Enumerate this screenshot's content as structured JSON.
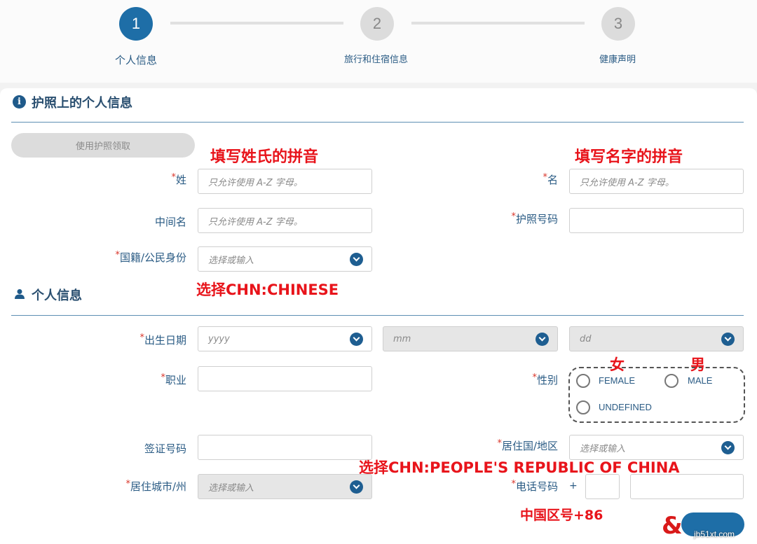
{
  "steps": [
    {
      "number": "1",
      "label": "个人信息"
    },
    {
      "number": "2",
      "label": "旅行和住宿信息"
    },
    {
      "number": "3",
      "label": "健康声明"
    }
  ],
  "passport_section": {
    "title": "护照上的个人信息",
    "read_button": "使用护照领取"
  },
  "personal_section": {
    "title": "个人信息"
  },
  "labels": {
    "surname": "姓",
    "given_name": "名",
    "middle_name": "中间名",
    "passport_no": "护照号码",
    "nationality": "国籍/公民身份",
    "dob": "出生日期",
    "occupation": "职业",
    "gender": "性别",
    "visa_no": "签证号码",
    "country_residence": "居住国/地区",
    "city_residence": "居住城市/州",
    "phone": "电话号码",
    "required_mark": "*",
    "phone_plus": "+"
  },
  "placeholders": {
    "alpha_only": "只允许使用 A-Z 字母。",
    "select_or_input": "选择或输入",
    "yyyy": "yyyy",
    "mm": "mm",
    "dd": "dd"
  },
  "gender_options": {
    "female": "FEMALE",
    "male": "MALE",
    "undefined": "UNDEFINED"
  },
  "annotations": {
    "surname_hint": "填写姓氏的拼音",
    "given_hint": "填写名字的拼音",
    "nationality_hint": "选择CHN:CHINESE",
    "female": "女",
    "male": "男",
    "country_hint": "选择CHN:PEOPLE'S REPUBLIC OF CHINA",
    "phone_hint": "中国区号+86"
  },
  "watermark": {
    "text": "jb51xt.com"
  },
  "colors": {
    "accent": "#1e6ea7",
    "annotation": "#e8141b",
    "required": "#d9362b"
  }
}
